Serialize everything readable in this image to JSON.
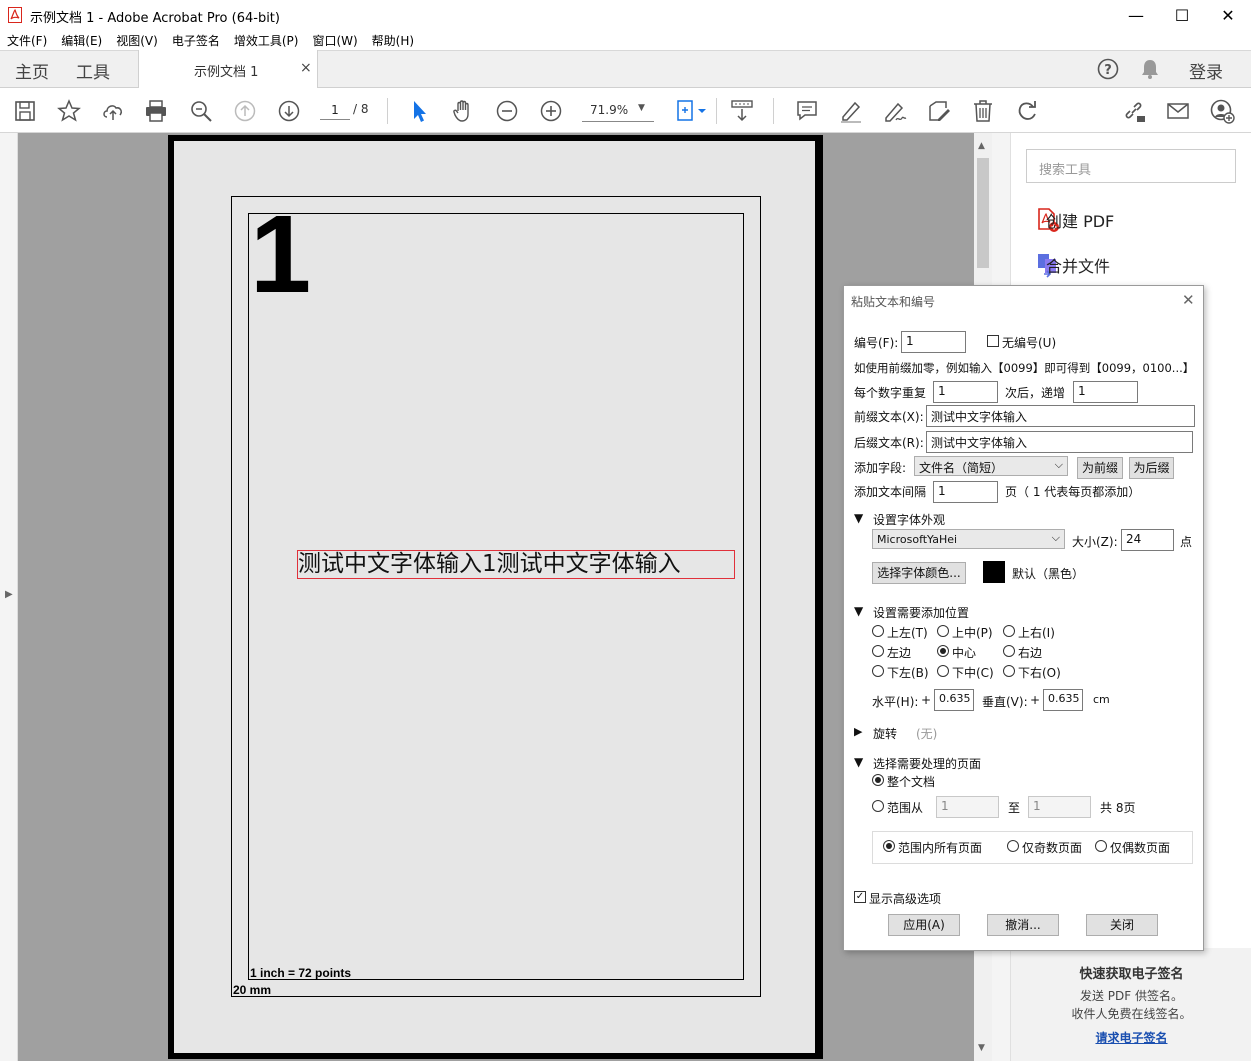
{
  "window": {
    "title": "示例文档 1 - Adobe Acrobat Pro (64-bit)",
    "minimize": "—",
    "maximize": "☐",
    "close": "✕"
  },
  "menu": [
    "文件(F)",
    "编辑(E)",
    "视图(V)",
    "电子签名",
    "增效工具(P)",
    "窗口(W)",
    "帮助(H)"
  ],
  "tabs": {
    "home": "主页",
    "tools": "工具",
    "document": "示例文档 1",
    "close": "×",
    "login": "登录"
  },
  "toolbar": {
    "page_current": "1",
    "page_total": "/ 8",
    "zoom": "71.9%"
  },
  "page": {
    "big_number": "1",
    "stamp_text": "测试中文字体输入1测试中文字体输入",
    "note_points": "1 inch = 72 points",
    "note_mm": "20 mm"
  },
  "right_pane": {
    "search_placeholder": "搜索工具",
    "create_pdf": "创建 PDF",
    "combine_files": "合并文件",
    "promo_title": "快速获取电子签名",
    "promo_line1": "发送 PDF 供签名。",
    "promo_line2": "收件人免费在线签名。",
    "promo_link": "请求电子签名"
  },
  "dialog": {
    "title": "粘贴文本和编号",
    "close": "✕",
    "number_label": "编号(F):",
    "number_value": "1",
    "no_number": "无编号(U)",
    "hint": "如使用前缀加零，例如输入【0099】即可得到【0099，0100...】",
    "repeat_label": "每个数字重复",
    "repeat_value": "1",
    "increment_label": "次后，递增",
    "increment_value": "1",
    "prefix_label": "前缀文本(X):",
    "prefix_value": "测试中文字体输入",
    "suffix_label": "后缀文本(R):",
    "suffix_value": "测试中文字体输入",
    "field_label": "添加字段:",
    "field_value": "文件名（简短）",
    "as_prefix": "为前缀",
    "as_suffix": "为后缀",
    "interval_label": "添加文本间隔",
    "interval_value": "1",
    "interval_note": "页（ 1 代表每页都添加）",
    "font_section": "设置字体外观",
    "font_value": "MicrosoftYaHei",
    "size_label": "大小(Z):",
    "size_value": "24",
    "size_unit": "点",
    "font_color_button": "选择字体颜色...",
    "font_color_name": "默认（黑色）",
    "font_color": "#000000",
    "position_section": "设置需要添加位置",
    "positions": [
      "上左(T)",
      "上中(P)",
      "上右(I)",
      "左边",
      "中心",
      "右边",
      "下左(B)",
      "下中(C)",
      "下右(O)"
    ],
    "position_selected": "中心",
    "h_label": "水平(H):",
    "h_sign": "+",
    "h_value": "0.635",
    "v_label": "垂直(V):",
    "v_sign": "+",
    "v_value": "0.635",
    "unit": "cm",
    "rotate_label": "旋转",
    "rotate_value": "(无)",
    "pages_section": "选择需要处理的页面",
    "whole_doc": "整个文档",
    "range_from": "范围从",
    "range_from_value": "1",
    "range_to": "至",
    "range_to_value": "1",
    "total_pages": "共 8页",
    "all_pages": "范围内所有页面",
    "odd_pages": "仅奇数页面",
    "even_pages": "仅偶数页面",
    "advanced": "显示高级选项",
    "apply": "应用(A)",
    "undo": "撤消...",
    "close_button": "关闭"
  },
  "colors": {
    "accent_blue": "#1473e6",
    "stamp_border": "#e0303a",
    "acrobat_red": "#d9261c"
  }
}
